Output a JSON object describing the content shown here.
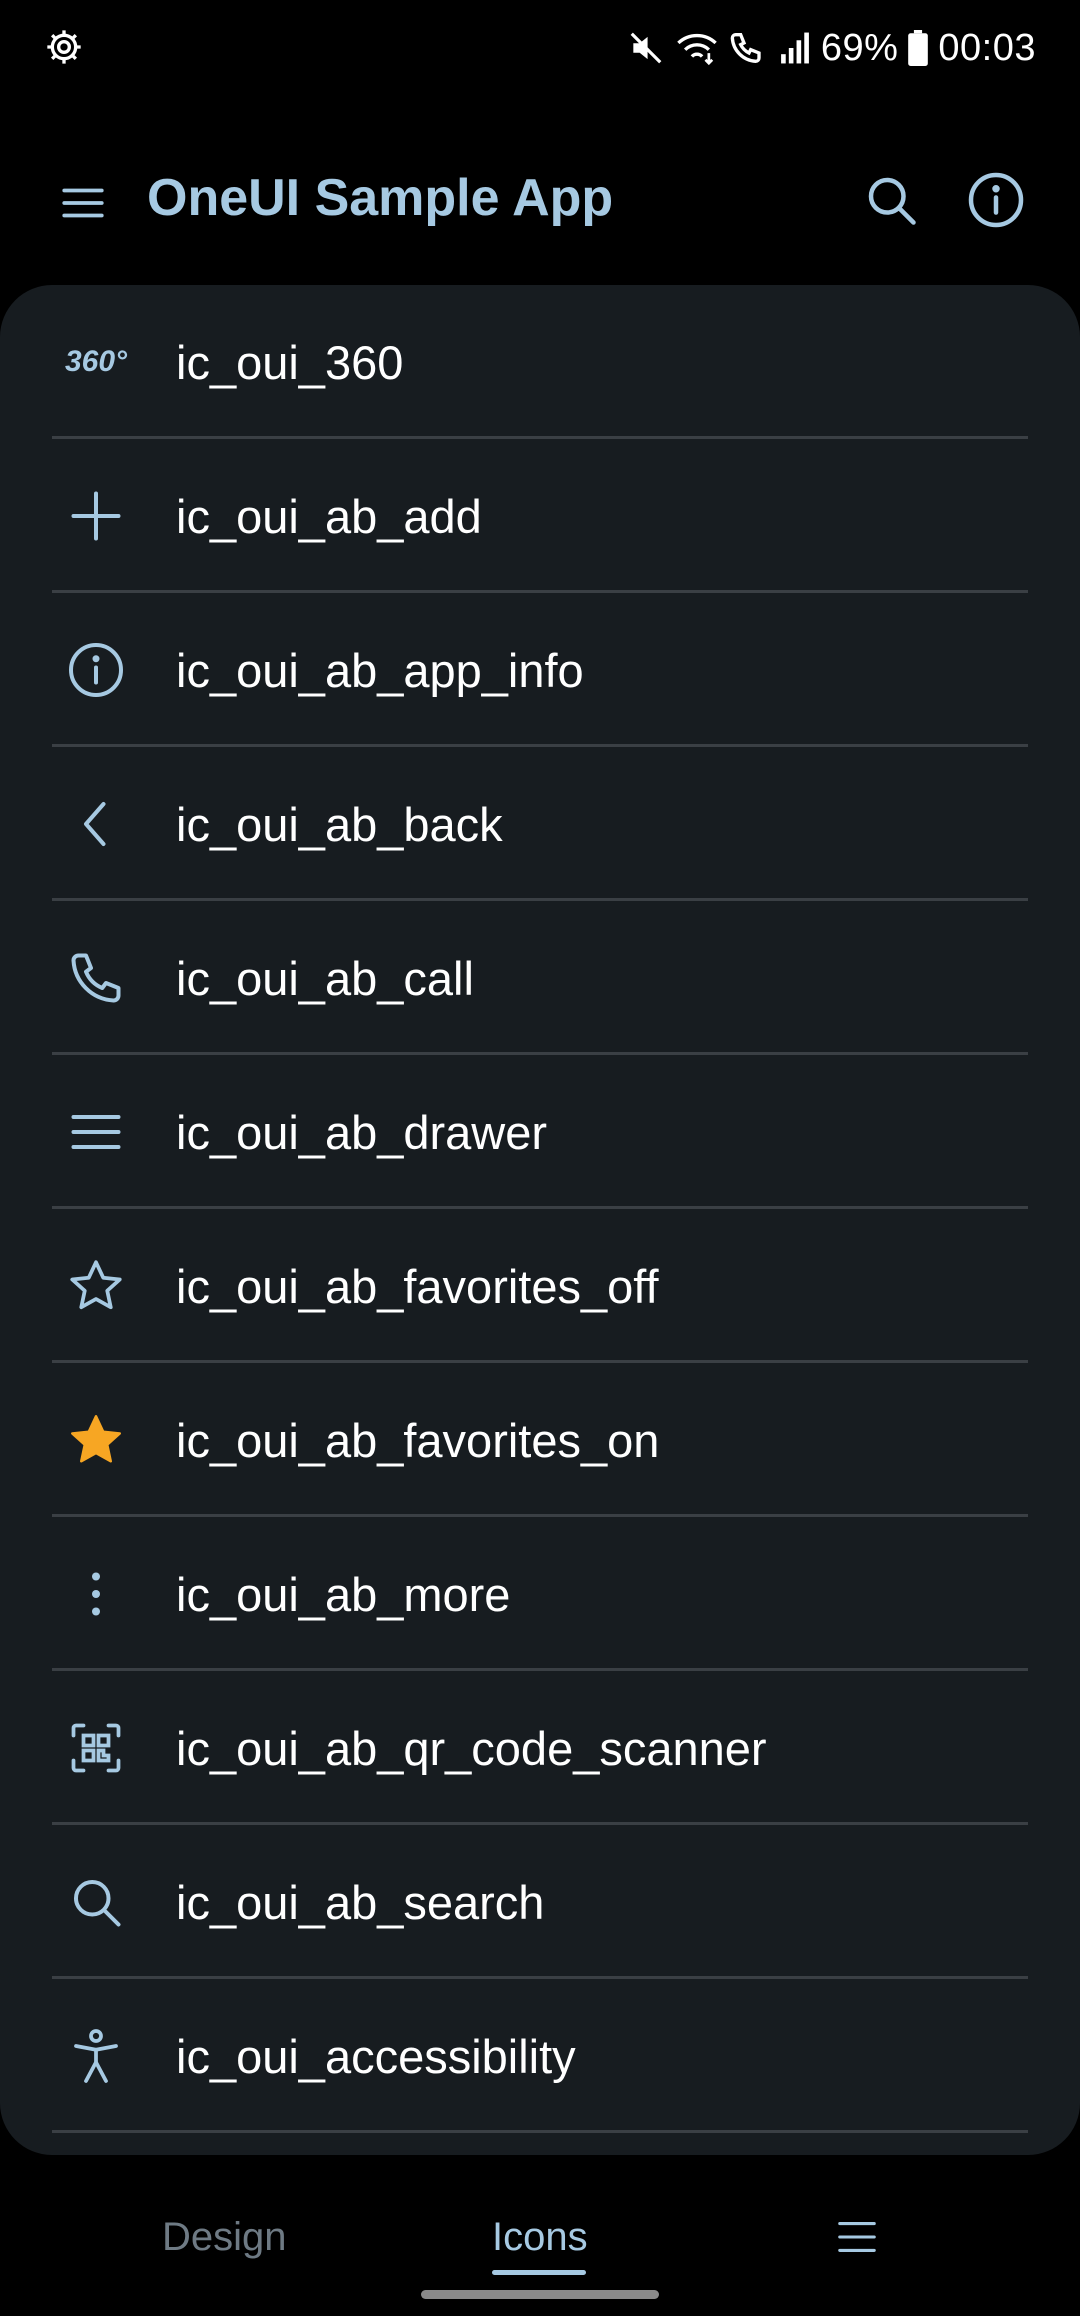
{
  "status_bar": {
    "battery_text": "69%",
    "time": "00:03",
    "icons": [
      "settings-gear-icon",
      "mute-icon",
      "wifi-icon",
      "wifi-call-icon",
      "signal-icon",
      "battery-icon"
    ]
  },
  "app_bar": {
    "title": "OneUI Sample App",
    "icons": [
      "drawer-menu-icon",
      "search-icon",
      "info-icon"
    ]
  },
  "icon_list": [
    {
      "label": "ic_oui_360",
      "icon": "360-icon",
      "icon_text": "360°"
    },
    {
      "label": "ic_oui_ab_add",
      "icon": "add-icon"
    },
    {
      "label": "ic_oui_ab_app_info",
      "icon": "info-icon"
    },
    {
      "label": "ic_oui_ab_back",
      "icon": "back-icon"
    },
    {
      "label": "ic_oui_ab_call",
      "icon": "call-icon"
    },
    {
      "label": "ic_oui_ab_drawer",
      "icon": "drawer-icon"
    },
    {
      "label": "ic_oui_ab_favorites_off",
      "icon": "star-outline-icon"
    },
    {
      "label": "ic_oui_ab_favorites_on",
      "icon": "star-filled-icon"
    },
    {
      "label": "ic_oui_ab_more",
      "icon": "more-icon"
    },
    {
      "label": "ic_oui_ab_qr_code_scanner",
      "icon": "qr-scanner-icon"
    },
    {
      "label": "ic_oui_ab_search",
      "icon": "search-icon"
    },
    {
      "label": "ic_oui_accessibility",
      "icon": "accessibility-icon"
    }
  ],
  "bottom_nav": {
    "tabs": [
      {
        "label": "Design",
        "selected": false
      },
      {
        "label": "Icons",
        "selected": true
      }
    ],
    "more_icon": "menu-icon"
  },
  "colors": {
    "accent": "#a6c9e2",
    "card_bg": "#171c20",
    "divider": "#3a3f44",
    "star_on": "#f7a623",
    "inactive_tab": "#6e7a84"
  }
}
